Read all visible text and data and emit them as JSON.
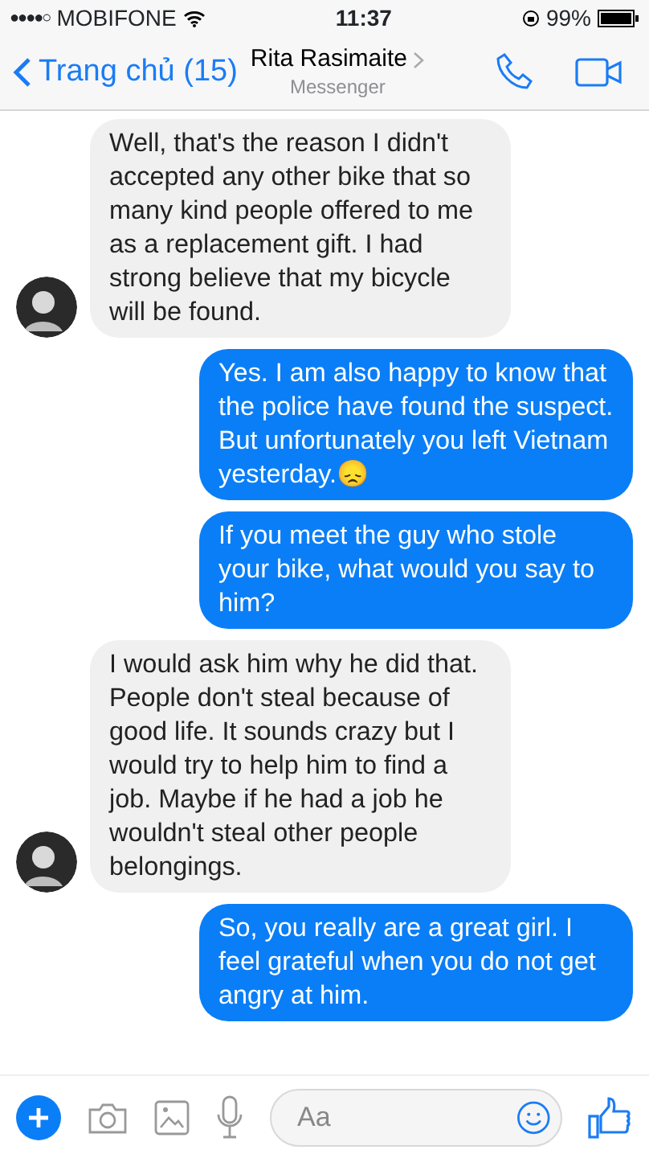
{
  "status_bar": {
    "signal": "●●●●○",
    "carrier": "MOBIFONE",
    "time": "11:37",
    "battery": "99%"
  },
  "header": {
    "back": "Trang chủ (15)",
    "name": "Rita Rasimaite",
    "subtitle": "Messenger"
  },
  "messages": [
    {
      "kind": "incoming",
      "text": "Well, that's the reason I didn't accepted any other bike that so many kind people offered to me as a replacement gift. I had strong believe that my bicycle will be found."
    },
    {
      "kind": "outgoing",
      "text": "Yes. I am also happy to know that the police have found the suspect. But unfortunately you left Vietnam yesterday.😞"
    },
    {
      "kind": "outgoing",
      "text": "If you meet the guy who stole your bike, what would you say to him?"
    },
    {
      "kind": "incoming",
      "text": "I would ask him why he did that. People don't steal because of good life. It sounds crazy but I would try to help him to find a job. Maybe if he had a job he wouldn't steal other people belongings."
    },
    {
      "kind": "outgoing",
      "text": "So, you really are a great girl. I feel grateful when you do not get angry at him."
    }
  ],
  "composer": {
    "placeholder": "Aa"
  }
}
